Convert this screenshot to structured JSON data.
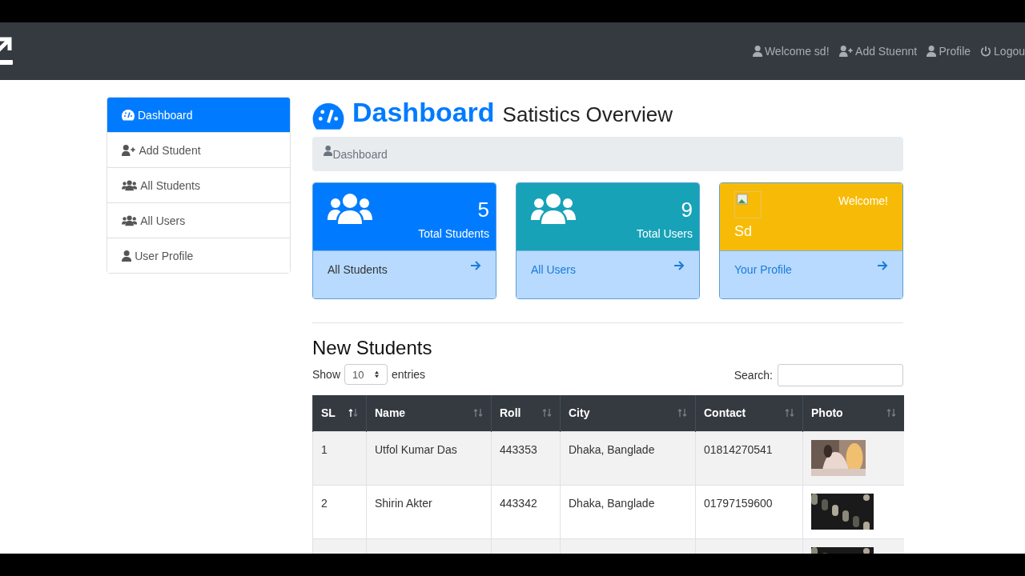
{
  "navbar": {
    "links": [
      {
        "kind": "user",
        "label": "Welcome sd!"
      },
      {
        "kind": "user-plus",
        "label": "Add Stuennt"
      },
      {
        "kind": "user",
        "label": "Profile"
      },
      {
        "kind": "power",
        "label": "Logou"
      }
    ]
  },
  "sidebar": {
    "items": [
      {
        "kind": "gauge",
        "label": "Dashboard",
        "selected": true
      },
      {
        "kind": "user-plus",
        "label": "Add Student",
        "selected": false
      },
      {
        "kind": "users",
        "label": "All Students",
        "selected": false
      },
      {
        "kind": "users",
        "label": "All Users",
        "selected": false
      },
      {
        "kind": "user",
        "label": "User Profile",
        "selected": false
      }
    ]
  },
  "header": {
    "title": "Dashboard",
    "subtitle": "Satistics Overview"
  },
  "breadcrumb": "Dashboard",
  "cards": [
    {
      "kind": "stat",
      "color": "#007bff",
      "value": "5",
      "label": "Total Students",
      "link": "All Students"
    },
    {
      "kind": "stat",
      "color": "#17a2b8",
      "value": "9",
      "label": "Total Users",
      "link": "All Users"
    },
    {
      "kind": "profile",
      "color": "#f7bb07",
      "name": "Sd",
      "greeting": "Welcome!",
      "link": "Your Profile"
    }
  ],
  "section_title": "New Students",
  "length_menu": {
    "before": "Show",
    "value": "10",
    "after": "entries"
  },
  "search": {
    "label": "Search:"
  },
  "table": {
    "columns": [
      {
        "label": "SL",
        "sorted": true
      },
      {
        "label": "Name",
        "sorted": false
      },
      {
        "label": "Roll",
        "sorted": false
      },
      {
        "label": "City",
        "sorted": false
      },
      {
        "label": "Contact",
        "sorted": false
      },
      {
        "label": "Photo",
        "sorted": false
      }
    ],
    "rows": [
      {
        "kind": "full",
        "cells": [
          "1",
          "Utfol Kumar Das",
          "443353",
          "Dhaka, Banglade",
          "01814270541"
        ]
      },
      {
        "kind": "full",
        "cells": [
          "2",
          "Shirin Akter",
          "443342",
          "Dhaka, Banglade",
          "01797159600"
        ]
      },
      {
        "kind": "cut"
      }
    ]
  }
}
